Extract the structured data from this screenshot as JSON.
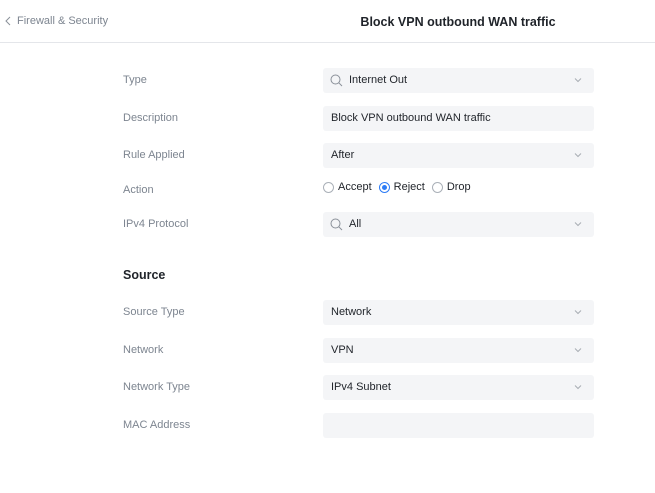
{
  "header": {
    "back_label": "Firewall & Security",
    "title": "Block VPN outbound WAN traffic"
  },
  "form": {
    "type": {
      "label": "Type",
      "value": "Internet Out"
    },
    "description": {
      "label": "Description",
      "value": "Block VPN outbound WAN traffic"
    },
    "rule_applied": {
      "label": "Rule Applied",
      "value": "After"
    },
    "action": {
      "label": "Action",
      "options": [
        "Accept",
        "Reject",
        "Drop"
      ],
      "selected": "Reject"
    },
    "ipv4_protocol": {
      "label": "IPv4 Protocol",
      "value": "All"
    }
  },
  "source": {
    "title": "Source",
    "source_type": {
      "label": "Source Type",
      "value": "Network"
    },
    "network": {
      "label": "Network",
      "value": "VPN"
    },
    "network_type": {
      "label": "Network Type",
      "value": "IPv4 Subnet"
    },
    "mac_address": {
      "label": "MAC Address",
      "value": ""
    }
  },
  "colors": {
    "accent": "#2d7cf6",
    "field_bg": "#f4f5f7",
    "label": "#7d8590"
  },
  "icons": {
    "back": "chevron-left-icon",
    "search": "search-icon",
    "dropdown": "chevron-down-icon"
  }
}
